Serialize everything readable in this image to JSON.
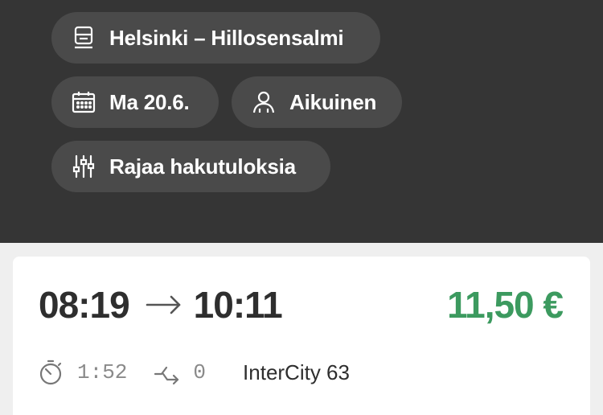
{
  "header": {
    "route_label": "Helsinki – Hillosensalmi",
    "date_label": "Ma 20.6.",
    "passenger_label": "Aikuinen",
    "filter_label": "Rajaa hakutuloksia"
  },
  "result": {
    "departure_time": "08:19",
    "arrival_time": "10:11",
    "price": "11,50 €",
    "duration": "1:52",
    "transfers": "0",
    "train_name": "InterCity 63"
  },
  "icons": {
    "route": "train-icon",
    "date": "calendar-icon",
    "passenger": "person-icon",
    "filter": "sliders-icon",
    "arrow": "arrow-right-icon",
    "duration": "stopwatch-icon",
    "transfers": "transfer-icon"
  },
  "colors": {
    "header_bg": "#353535",
    "chip_bg": "#4a4a4a",
    "price": "#3c9a5f",
    "page_bg": "#efefef"
  }
}
